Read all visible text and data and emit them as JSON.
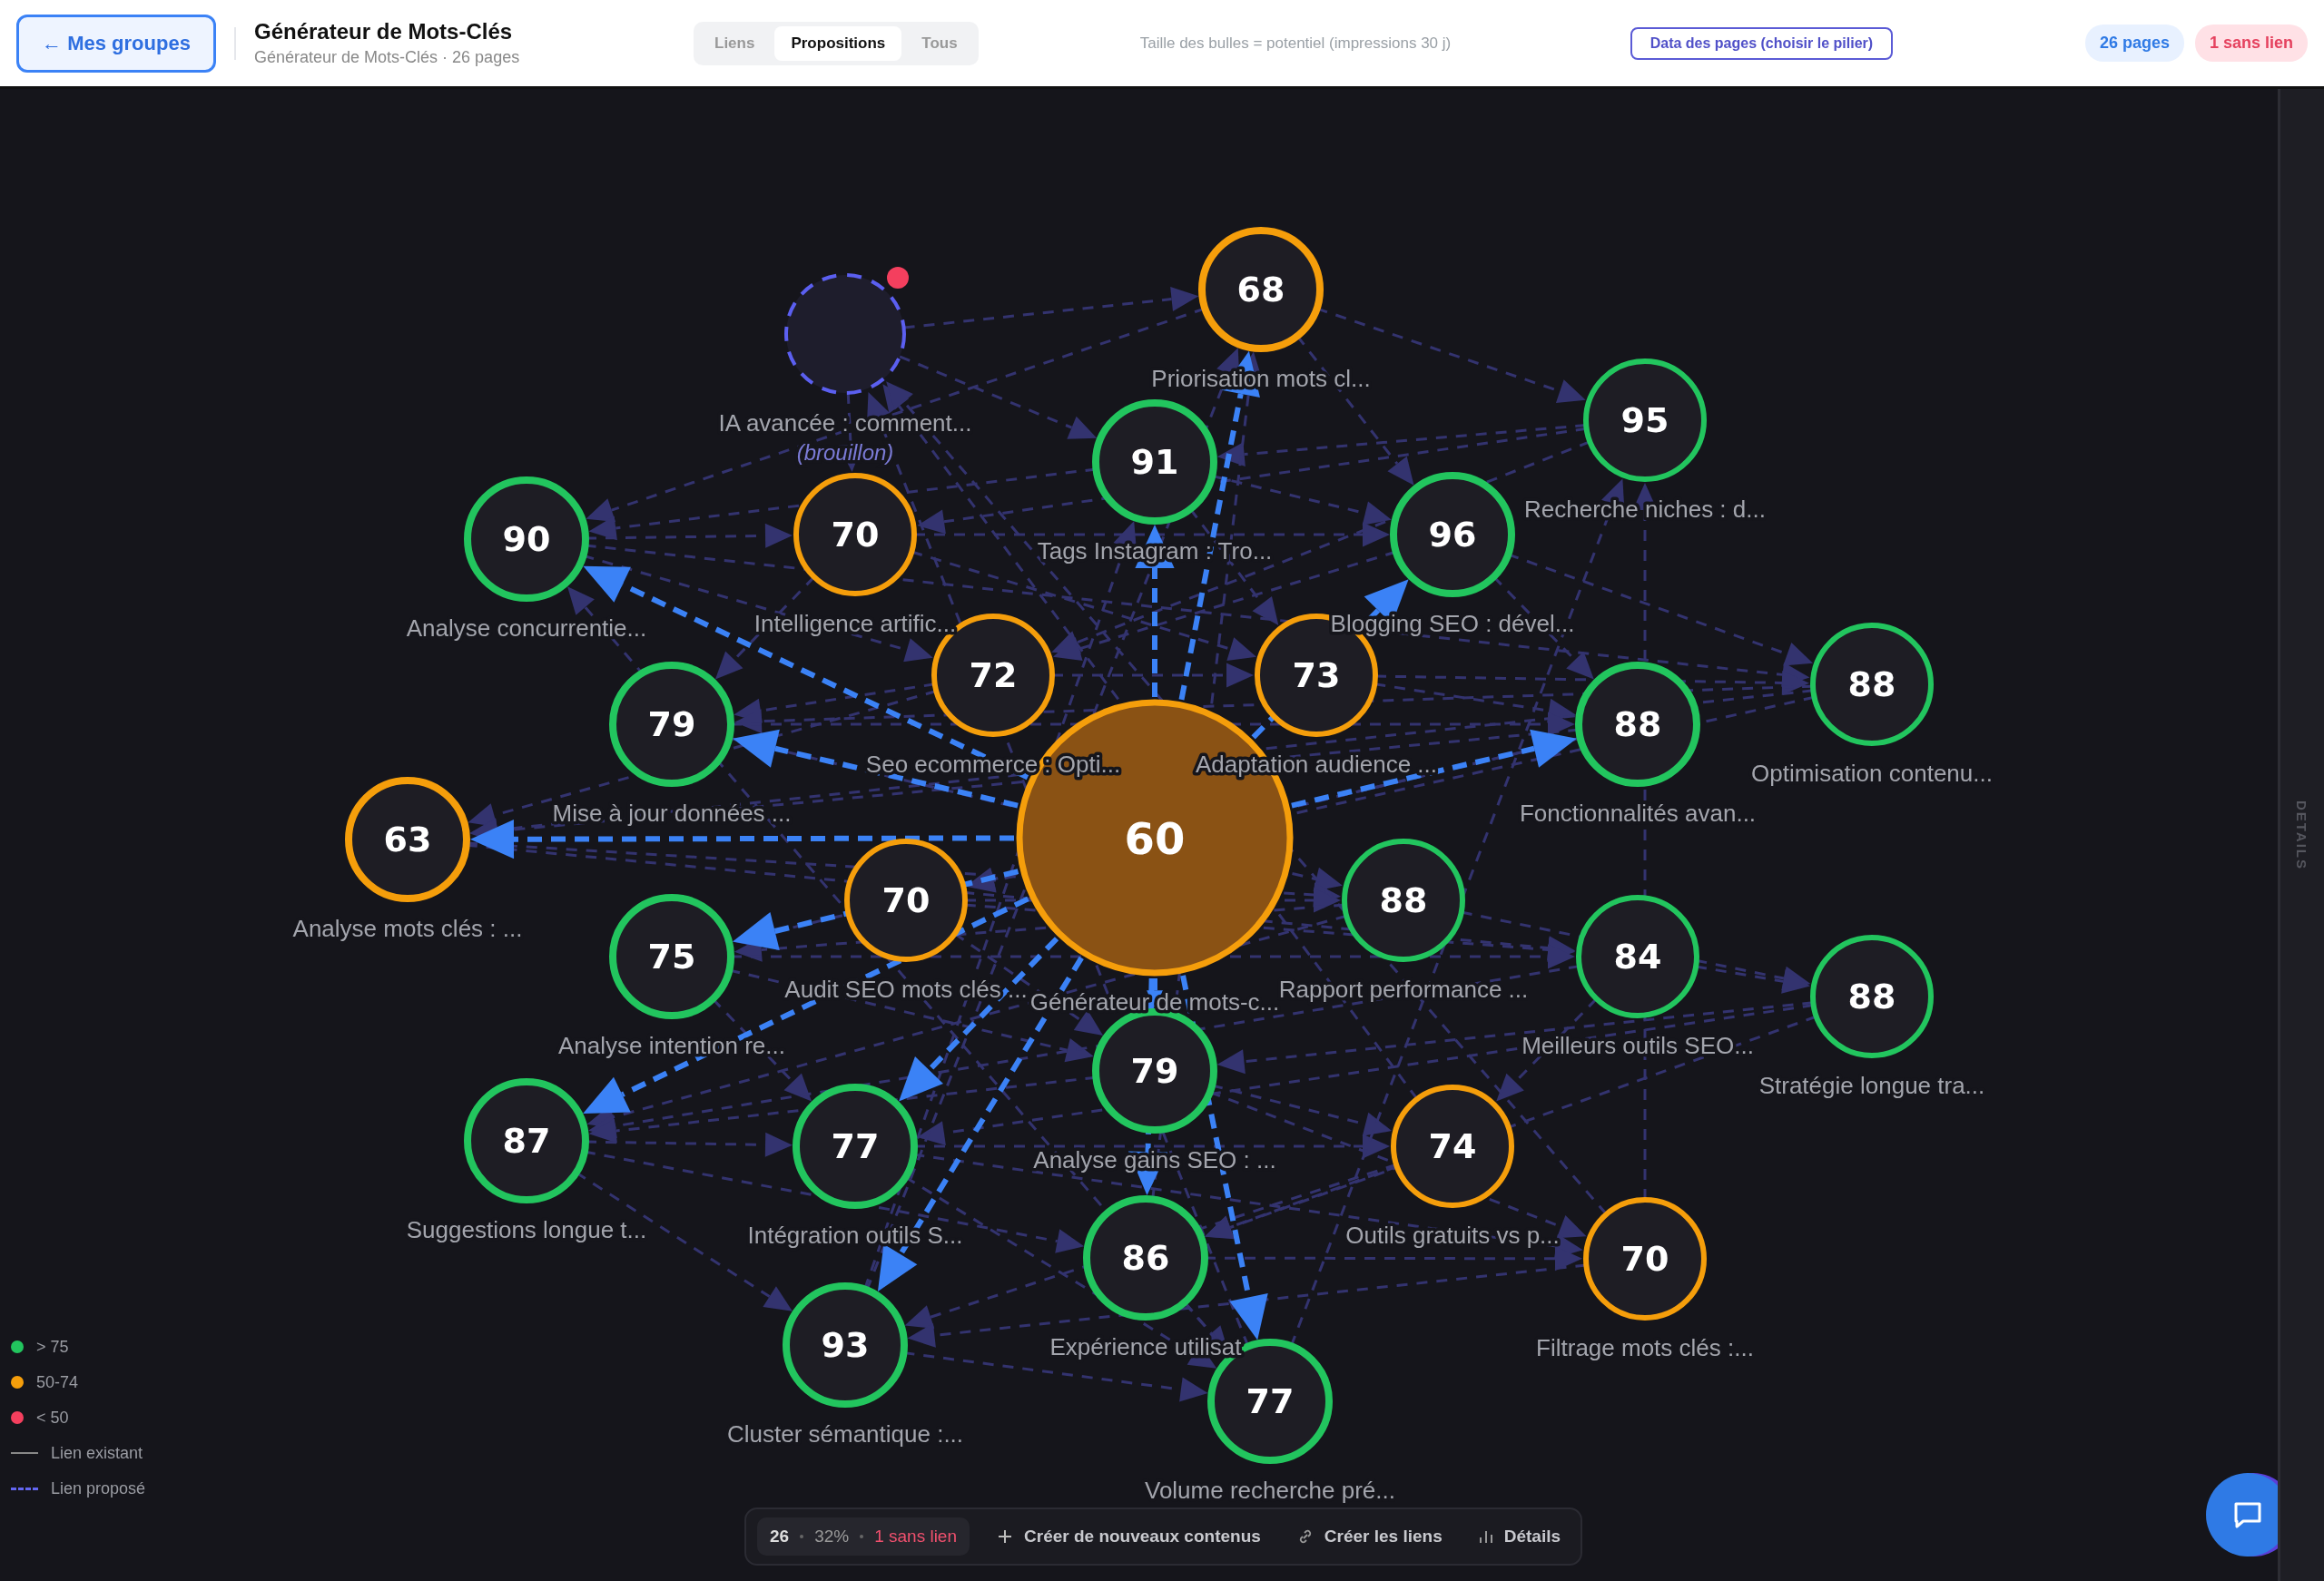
{
  "header": {
    "back_button": "← Mes groupes",
    "title": "Générateur de Mots-Clés",
    "subtitle": "Générateur de Mots-Clés · 26 pages",
    "tabs": [
      {
        "label": "Liens",
        "selected": false
      },
      {
        "label": "Propositions",
        "selected": true
      },
      {
        "label": "Tous",
        "selected": false
      }
    ],
    "hint": "Taille des bulles = potentiel (impressions 30 j)",
    "data_button": "Data des pages (choisir le pilier)",
    "badges": [
      {
        "text": "26 pages",
        "kind": "info"
      },
      {
        "text": "1 sans lien",
        "kind": "alert"
      }
    ]
  },
  "nodes": [
    {
      "kind": "draft",
      "label": "IA avancée : comment...",
      "note": "(brouillon)",
      "color": "#f43f5e"
    },
    {
      "kind": "page",
      "score": "68",
      "label": "Priorisation mots cl...",
      "color": "#f59e0b",
      "proposed": true
    },
    {
      "kind": "page",
      "score": "95",
      "label": "Recherche niches : d...",
      "color": "#22c55e",
      "proposed": false
    },
    {
      "kind": "page",
      "score": "91",
      "label": "Tags Instagram : Tro...",
      "color": "#22c55e",
      "proposed": true
    },
    {
      "kind": "page",
      "score": "90",
      "label": "Analyse concurrentie...",
      "color": "#22c55e",
      "proposed": true
    },
    {
      "kind": "page",
      "score": "70",
      "label": "Intelligence artific...",
      "color": "#f59e0b",
      "proposed": false
    },
    {
      "kind": "page",
      "score": "96",
      "label": "Blogging SEO : dével...",
      "color": "#22c55e",
      "proposed": true
    },
    {
      "kind": "page",
      "score": "72",
      "label": "Seo ecommerce : Opti...",
      "color": "#f59e0b",
      "proposed": false
    },
    {
      "kind": "page",
      "score": "73",
      "label": "Adaptation audience ...",
      "color": "#f59e0b",
      "proposed": false
    },
    {
      "kind": "page",
      "score": "88",
      "label": "Optimisation contenu...",
      "color": "#22c55e",
      "proposed": false
    },
    {
      "kind": "page",
      "score": "79",
      "label": "Mise à jour données ...",
      "color": "#22c55e",
      "proposed": true
    },
    {
      "kind": "page",
      "score": "88",
      "label": "Fonctionnalités avan...",
      "color": "#22c55e",
      "proposed": true
    },
    {
      "kind": "page",
      "score": "63",
      "label": "Analyse mots clés : ...",
      "color": "#f59e0b",
      "proposed": true
    },
    {
      "kind": "pillar",
      "score": "60",
      "label": "Générateur de mots-c...",
      "color": "#f59e0b"
    },
    {
      "kind": "page",
      "score": "70",
      "label": "Audit SEO mots clés ...",
      "color": "#f59e0b",
      "proposed": false
    },
    {
      "kind": "page",
      "score": "88",
      "label": "Rapport performance ...",
      "color": "#22c55e",
      "proposed": false
    },
    {
      "kind": "page",
      "score": "75",
      "label": "Analyse intention re...",
      "color": "#22c55e",
      "proposed": true
    },
    {
      "kind": "page",
      "score": "84",
      "label": "Meilleurs outils SEO...",
      "color": "#22c55e",
      "proposed": false
    },
    {
      "kind": "page",
      "score": "88",
      "label": "Stratégie longue tra...",
      "color": "#22c55e",
      "proposed": false
    },
    {
      "kind": "page",
      "score": "79",
      "label": "Analyse gains SEO : ...",
      "color": "#22c55e",
      "proposed": true
    },
    {
      "kind": "page",
      "score": "87",
      "label": "Suggestions longue t...",
      "color": "#22c55e",
      "proposed": true
    },
    {
      "kind": "page",
      "score": "77",
      "label": "Intégration outils S...",
      "color": "#22c55e",
      "proposed": true
    },
    {
      "kind": "page",
      "score": "74",
      "label": "Outils gratuits vs p...",
      "color": "#f59e0b",
      "proposed": false
    },
    {
      "kind": "page",
      "score": "86",
      "label": "Expérience utilisat",
      "color": "#22c55e",
      "proposed": true
    },
    {
      "kind": "page",
      "score": "70",
      "label": "Filtrage mots clés :...",
      "color": "#f59e0b",
      "proposed": false
    },
    {
      "kind": "page",
      "score": "93",
      "label": "Cluster sémantique :...",
      "color": "#22c55e",
      "proposed": true
    },
    {
      "kind": "page",
      "score": "77",
      "label": "Volume recherche pré...",
      "color": "#22c55e",
      "proposed": true
    }
  ],
  "legend": [
    {
      "kind": "dot",
      "label": "> 75",
      "color": "#22c55e"
    },
    {
      "kind": "dot",
      "label": "50-74",
      "color": "#f59e0b"
    },
    {
      "kind": "dot",
      "label": "< 50",
      "color": "#f43f5e"
    },
    {
      "kind": "solid",
      "label": "Lien existant"
    },
    {
      "kind": "dashed",
      "label": "Lien proposé"
    }
  ],
  "toolbar": {
    "count": "26",
    "percent": "32%",
    "unlinked": "1 sans lien",
    "actions": [
      {
        "kind": "plus",
        "label": "Créer de nouveaux contenus"
      },
      {
        "kind": "link",
        "label": "Créer les liens"
      },
      {
        "kind": "chart",
        "label": "Détails"
      }
    ]
  },
  "side_panel": {
    "label": "DETAILS"
  }
}
